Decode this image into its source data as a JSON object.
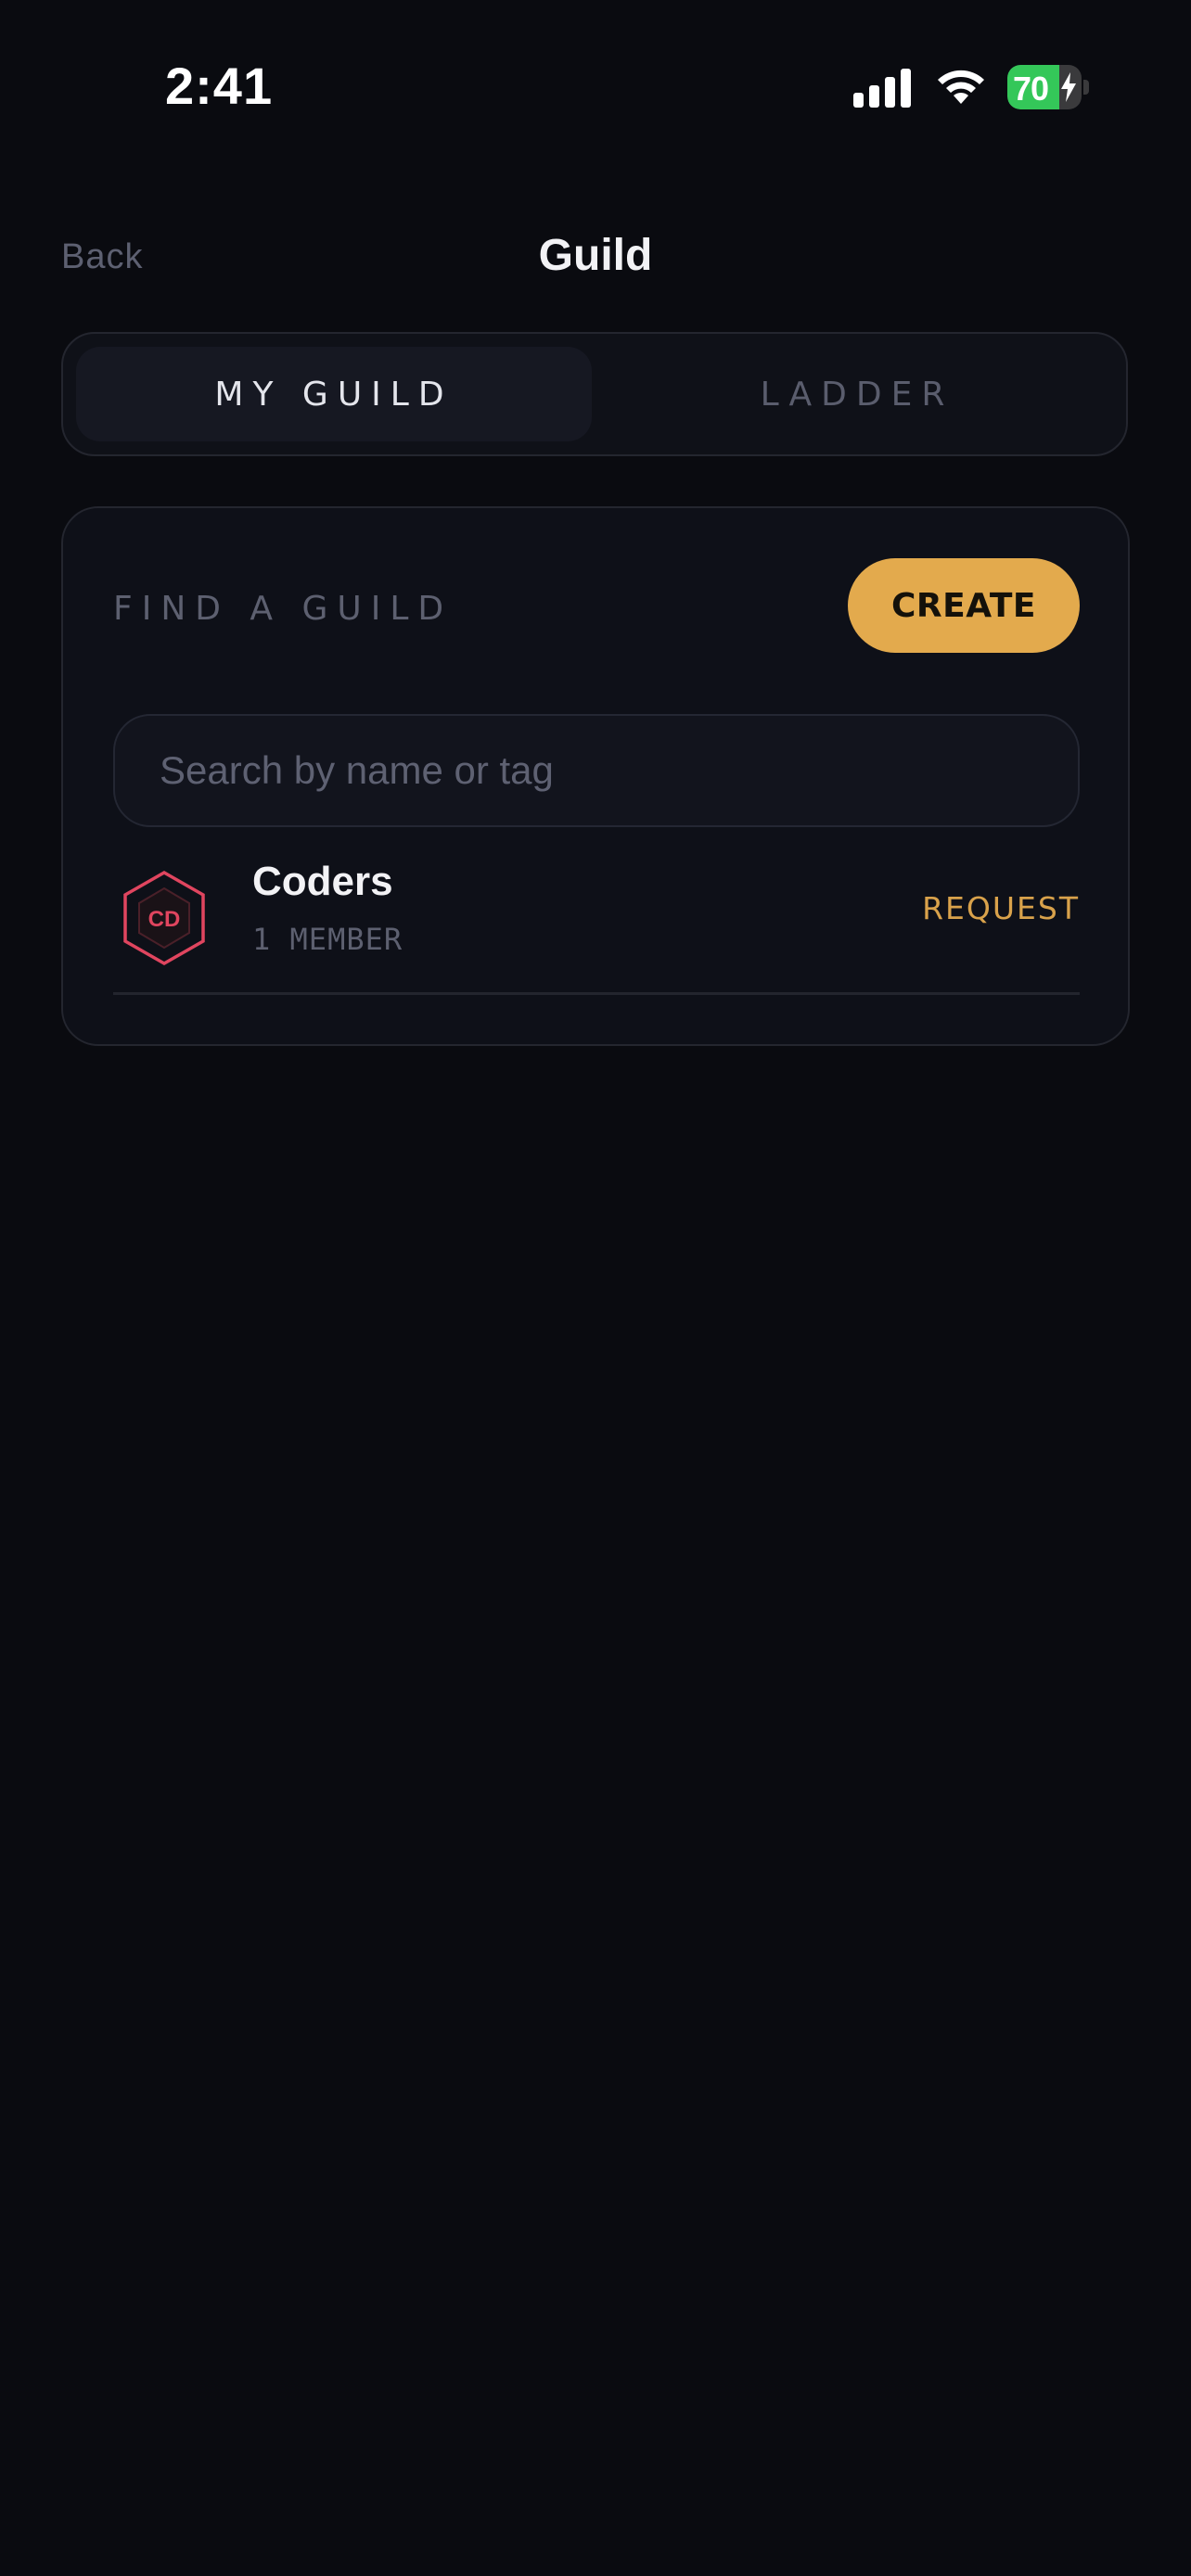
{
  "status_bar": {
    "time": "2:41",
    "battery_level": "70",
    "battery_fraction": 0.7,
    "battery_color": "#34c759"
  },
  "nav": {
    "back_label": "Back",
    "title": "Guild"
  },
  "tabs": [
    {
      "label": "MY GUILD",
      "active": true
    },
    {
      "label": "LADDER",
      "active": false
    }
  ],
  "find_guild": {
    "heading": "FIND A GUILD",
    "create_label": "CREATE",
    "search_placeholder": "Search by name or tag",
    "accent_color": "#e3aa4d"
  },
  "guilds": [
    {
      "name": "Coders",
      "tag": "CD",
      "members": "1 MEMBER",
      "action": "REQUEST",
      "badge_color": "#e0455f",
      "icon": "hexagon-badge-icon"
    }
  ]
}
